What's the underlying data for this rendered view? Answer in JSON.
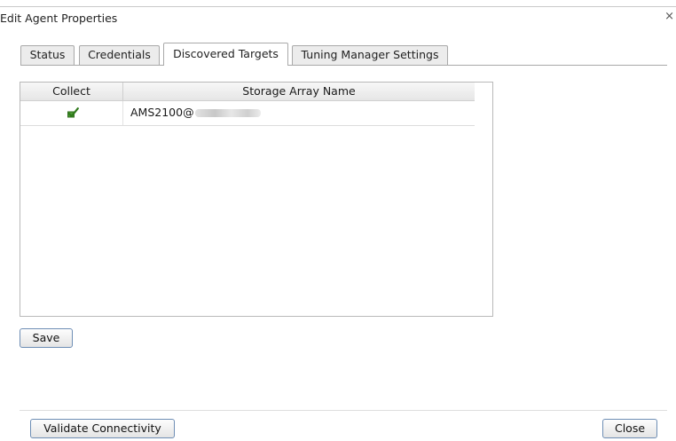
{
  "window": {
    "title": "Edit Agent Properties",
    "close_glyph": "×"
  },
  "tabs": [
    {
      "label": "Status",
      "active": false
    },
    {
      "label": "Credentials",
      "active": false
    },
    {
      "label": "Discovered Targets",
      "active": true
    },
    {
      "label": "Tuning Manager Settings",
      "active": false
    }
  ],
  "table": {
    "columns": [
      "Collect",
      "Storage Array Name"
    ],
    "rows": [
      {
        "collect": true,
        "collect_icon": "green-check-icon",
        "name": "AMS2100@"
      }
    ]
  },
  "buttons": {
    "save": "Save",
    "validate": "Validate Connectivity",
    "close": "Close"
  },
  "colors": {
    "check_green": "#3f8f2a",
    "button_border": "#6e8eb5"
  }
}
